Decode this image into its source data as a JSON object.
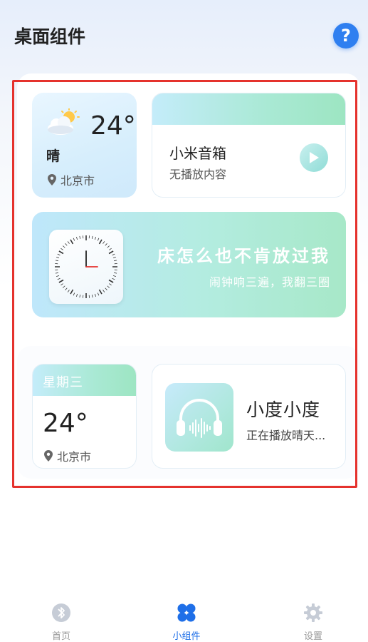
{
  "header": {
    "title": "桌面组件",
    "help_icon": "?"
  },
  "weather": {
    "temp": "24°",
    "condition": "晴",
    "location": "北京市"
  },
  "speaker": {
    "name": "小米音箱",
    "status": "无播放内容"
  },
  "alarm": {
    "title": "床怎么也不肯放过我",
    "subtitle": "闹钟响三遍，我翻三圈"
  },
  "weekday": {
    "label": "星期三",
    "temp": "24°",
    "location": "北京市"
  },
  "xiaodu": {
    "name": "小度小度",
    "status": "正在播放晴天..."
  },
  "nav": {
    "items": [
      {
        "label": "首页",
        "icon": "bluetooth-icon"
      },
      {
        "label": "小组件",
        "icon": "widgets-icon"
      },
      {
        "label": "设置",
        "icon": "gear-icon"
      }
    ],
    "active": "小组件"
  },
  "colors": {
    "accent": "#1f6fe8",
    "help": "#2f7ff0",
    "highlight_frame": "#e5322d"
  }
}
